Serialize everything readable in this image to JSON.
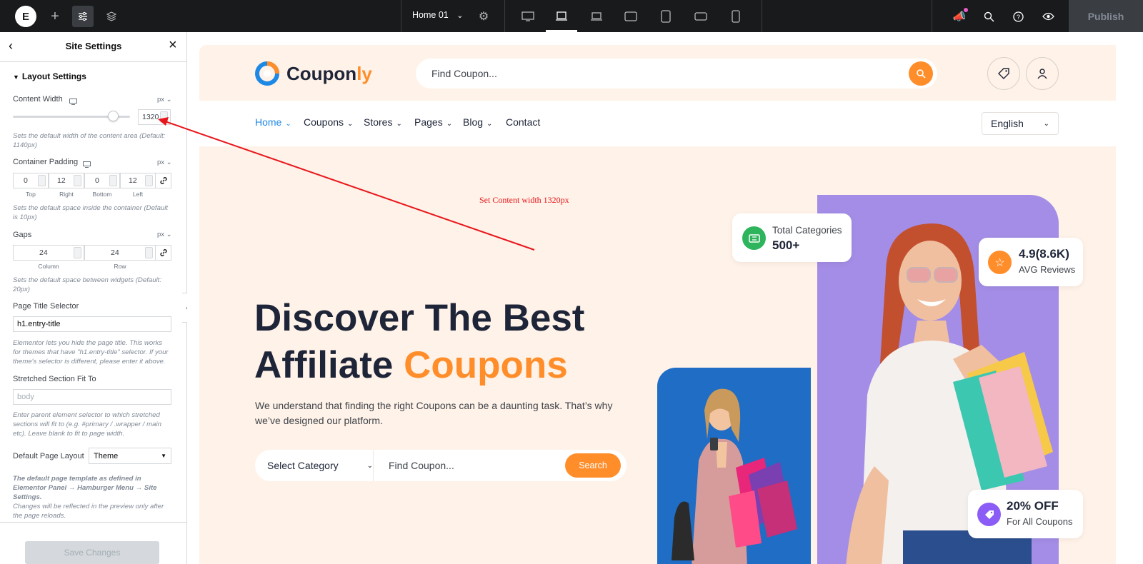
{
  "topbar": {
    "logo": "E",
    "page_name": "Home 01",
    "publish": "Publish",
    "icons": [
      "add-icon",
      "settings-sliders-icon",
      "layers-icon",
      "gear-icon",
      "desktop-icon",
      "laptop-icon",
      "laptop-small-icon",
      "tablet-landscape-icon",
      "tablet-portrait-icon",
      "mobile-landscape-icon",
      "mobile-portrait-icon",
      "notifications-icon",
      "search-icon",
      "help-icon",
      "preview-eye-icon"
    ]
  },
  "panel": {
    "title": "Site Settings",
    "section": "Layout Settings",
    "content_width": {
      "label": "Content Width",
      "unit": "px",
      "value": "1320",
      "slider_fraction": 0.88,
      "help": "Sets the default width of the content area (Default: 1140px)"
    },
    "container_padding": {
      "label": "Container Padding",
      "unit": "px",
      "values": [
        "0",
        "12",
        "0",
        "12"
      ],
      "captions": [
        "Top",
        "Right",
        "Bottom",
        "Left"
      ],
      "help": "Sets the default space inside the container (Default is 10px)"
    },
    "gaps": {
      "label": "Gaps",
      "unit": "px",
      "values": [
        "24",
        "24"
      ],
      "captions": [
        "Column",
        "Row"
      ],
      "help": "Sets the default space between widgets (Default: 20px)"
    },
    "page_title_selector": {
      "label": "Page Title Selector",
      "value": "h1.entry-title",
      "help": "Elementor lets you hide the page title. This works for themes that have \"h1.entry-title\" selector. If your theme's selector is different, please enter it above."
    },
    "stretched_section": {
      "label": "Stretched Section Fit To",
      "placeholder": "body",
      "help": "Enter parent element selector to which stretched sections will fit to (e.g. #primary / .wrapper / main etc). Leave blank to fit to page width."
    },
    "default_page_layout": {
      "label": "Default Page Layout",
      "value": "Theme",
      "help": "The default page template as defined in Elementor Panel → Hamburger Menu → Site Settings."
    },
    "reload_note": "Changes will be reflected in the preview only after the page reloads.",
    "save_button": "Save Changes"
  },
  "annotation": {
    "text": "Set Content width 1320px",
    "color": "#e8161b"
  },
  "site": {
    "logo_pre": "Coupon",
    "logo_post": "ly",
    "search_placeholder": "Find Coupon...",
    "nav": [
      "Home",
      "Coupons",
      "Stores",
      "Pages",
      "Blog",
      "Contact"
    ],
    "language": "English",
    "hero_line1": "Discover The Best",
    "hero_line2a": "Affiliate",
    "hero_line2b": "Coupons",
    "hero_desc_1": "We understand that finding the right Coupons can be a daunting task. That’s why",
    "hero_desc_2": "we’ve designed our platform.",
    "category_select": "Select Category",
    "find_placeholder": "Find Coupon...",
    "search_button": "Search",
    "stat1_label": "Total Categories",
    "stat1_value": "500+",
    "stat2_value": "4.9(8.6K)",
    "stat2_label": "AVG Reviews",
    "stat3_value": "20% OFF",
    "stat3_label": "For All Coupons",
    "accent": "#ff8d2a",
    "dark": "#1e2538"
  }
}
